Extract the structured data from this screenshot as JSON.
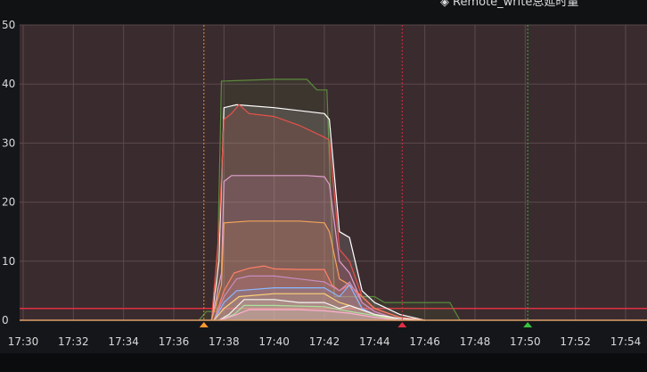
{
  "panel": {
    "legend_hint_text": "Remote_write总延时量",
    "legend_hint_icon": "diamond-icon"
  },
  "colors": {
    "background": "#3a2b2e",
    "grid": "#5a4a4d",
    "threshold": "#e02f44",
    "annotation_orange": "#ff9830",
    "annotation_red": "#e02f44",
    "annotation_green": "#37c23f"
  },
  "chart_data": {
    "type": "area",
    "title": "",
    "xlabel": "",
    "ylabel": "",
    "xlim": [
      "17:30",
      "17:54"
    ],
    "ylim": [
      0,
      50
    ],
    "x_ticks": [
      "17:30",
      "17:32",
      "17:34",
      "17:36",
      "17:38",
      "17:40",
      "17:42",
      "17:44",
      "17:46",
      "17:48",
      "17:50",
      "17:52",
      "17:54"
    ],
    "y_ticks": [
      0,
      10,
      20,
      30,
      40,
      50
    ],
    "grid": true,
    "stacked": false,
    "threshold": 2,
    "annotations": [
      {
        "time": "17:37.2",
        "color": "orange"
      },
      {
        "time": "17:45.1",
        "color": "red"
      },
      {
        "time": "17:50.1",
        "color": "green"
      }
    ],
    "series": [
      {
        "color": "#5a8a3c",
        "points": [
          [
            "17:37",
            0
          ],
          [
            "17:37.3",
            1.5
          ],
          [
            "17:37.7",
            1.5
          ],
          [
            "17:37.9",
            40.5
          ],
          [
            "17:40",
            40.8
          ],
          [
            "17:41.3",
            40.8
          ],
          [
            "17:41.7",
            39
          ],
          [
            "17:42.1",
            39
          ],
          [
            "17:42.4",
            4
          ],
          [
            "17:44",
            4
          ],
          [
            "17:44.4",
            3
          ],
          [
            "17:47",
            3
          ],
          [
            "17:47.4",
            0
          ]
        ]
      },
      {
        "color": "#ffffff",
        "points": [
          [
            "17:37.5",
            0
          ],
          [
            "17:37.8",
            10
          ],
          [
            "17:38",
            36
          ],
          [
            "17:38.5",
            36.5
          ],
          [
            "17:40",
            36
          ],
          [
            "17:42",
            35
          ],
          [
            "17:42.2",
            34
          ],
          [
            "17:42.6",
            15
          ],
          [
            "17:43",
            14
          ],
          [
            "17:43.5",
            5
          ],
          [
            "17:44",
            3
          ],
          [
            "17:45",
            1
          ],
          [
            "17:46",
            0
          ]
        ]
      },
      {
        "color": "#e8504a",
        "points": [
          [
            "17:37.5",
            0
          ],
          [
            "17:37.8",
            15
          ],
          [
            "17:38",
            34
          ],
          [
            "17:38.3",
            35
          ],
          [
            "17:38.6",
            36.5
          ],
          [
            "17:39",
            35
          ],
          [
            "17:40",
            34.5
          ],
          [
            "17:41",
            33
          ],
          [
            "17:42",
            31
          ],
          [
            "17:42.2",
            30.5
          ],
          [
            "17:42.6",
            12
          ],
          [
            "17:43",
            10
          ],
          [
            "17:43.5",
            4
          ],
          [
            "17:44",
            2
          ],
          [
            "17:45",
            0.5
          ],
          [
            "17:46",
            0
          ]
        ]
      },
      {
        "color": "#e0a0d0",
        "points": [
          [
            "17:37.5",
            0
          ],
          [
            "17:37.9",
            8
          ],
          [
            "17:38",
            23.5
          ],
          [
            "17:38.3",
            24.5
          ],
          [
            "17:40",
            24.5
          ],
          [
            "17:41.3",
            24.5
          ],
          [
            "17:42",
            24.3
          ],
          [
            "17:42.2",
            23
          ],
          [
            "17:42.6",
            10
          ],
          [
            "17:43",
            8
          ],
          [
            "17:43.5",
            3
          ],
          [
            "17:44",
            1.5
          ],
          [
            "17:45",
            0
          ]
        ]
      },
      {
        "color": "#f2a35a",
        "points": [
          [
            "17:37.5",
            0
          ],
          [
            "17:37.9",
            6
          ],
          [
            "17:38",
            16.5
          ],
          [
            "17:39",
            16.8
          ],
          [
            "17:41",
            16.8
          ],
          [
            "17:42",
            16.5
          ],
          [
            "17:42.2",
            15
          ],
          [
            "17:42.6",
            7
          ],
          [
            "17:43",
            6
          ],
          [
            "17:43.5",
            2
          ],
          [
            "17:44",
            1
          ],
          [
            "17:45",
            0
          ]
        ]
      },
      {
        "color": "#ff7f66",
        "points": [
          [
            "17:37.6",
            0
          ],
          [
            "17:38",
            5
          ],
          [
            "17:38.4",
            8
          ],
          [
            "17:39",
            8.8
          ],
          [
            "17:39.6",
            9.2
          ],
          [
            "17:40",
            8.7
          ],
          [
            "17:41",
            8.6
          ],
          [
            "17:42",
            8.6
          ],
          [
            "17:42.3",
            6
          ],
          [
            "17:42.6",
            5
          ],
          [
            "17:43",
            6
          ],
          [
            "17:43.5",
            4
          ],
          [
            "17:44",
            2
          ],
          [
            "17:45",
            0.5
          ],
          [
            "17:46",
            0
          ]
        ]
      },
      {
        "color": "#c88cc0",
        "points": [
          [
            "17:37.6",
            0
          ],
          [
            "17:38",
            4
          ],
          [
            "17:38.5",
            7
          ],
          [
            "17:39",
            7.5
          ],
          [
            "17:40",
            7.5
          ],
          [
            "17:41",
            7
          ],
          [
            "17:42",
            6.5
          ],
          [
            "17:42.6",
            5
          ],
          [
            "17:43",
            6.5
          ],
          [
            "17:43.5",
            3
          ],
          [
            "17:44",
            1.5
          ],
          [
            "17:45",
            0
          ]
        ]
      },
      {
        "color": "#8ab8ff",
        "points": [
          [
            "17:37.6",
            0
          ],
          [
            "17:38",
            3
          ],
          [
            "17:38.5",
            5
          ],
          [
            "17:40",
            5.5
          ],
          [
            "17:42",
            5.5
          ],
          [
            "17:42.6",
            4
          ],
          [
            "17:43",
            6
          ],
          [
            "17:43.5",
            2
          ],
          [
            "17:44",
            1
          ],
          [
            "17:45",
            0
          ]
        ]
      },
      {
        "color": "#ffd27a",
        "points": [
          [
            "17:37.6",
            0
          ],
          [
            "17:38",
            2
          ],
          [
            "17:38.6",
            4
          ],
          [
            "17:40",
            4.5
          ],
          [
            "17:42",
            4.5
          ],
          [
            "17:42.6",
            3
          ],
          [
            "17:43",
            2.5
          ],
          [
            "17:44",
            1
          ],
          [
            "17:45",
            0
          ]
        ]
      },
      {
        "color": "#f5f5f5",
        "points": [
          [
            "17:37.8",
            0
          ],
          [
            "17:38.2",
            1
          ],
          [
            "17:38.8",
            3.5
          ],
          [
            "17:40",
            3.5
          ],
          [
            "17:41",
            3
          ],
          [
            "17:42",
            3
          ],
          [
            "17:42.6",
            2
          ],
          [
            "17:43",
            2.5
          ],
          [
            "17:44",
            1
          ],
          [
            "17:45",
            0.3
          ],
          [
            "17:46",
            0
          ]
        ]
      },
      {
        "color": "#b0e0a0",
        "points": [
          [
            "17:37.8",
            0
          ],
          [
            "17:38.4",
            1
          ],
          [
            "17:38.8",
            2.5
          ],
          [
            "17:40",
            2.5
          ],
          [
            "17:42",
            2.3
          ],
          [
            "17:43",
            1.5
          ],
          [
            "17:44",
            0.8
          ],
          [
            "17:45",
            0
          ]
        ]
      },
      {
        "color": "#ffb0d0",
        "points": [
          [
            "17:37.8",
            0
          ],
          [
            "17:38.4",
            0.8
          ],
          [
            "17:39",
            1.8
          ],
          [
            "17:41",
            1.8
          ],
          [
            "17:42",
            1.6
          ],
          [
            "17:43",
            1.2
          ],
          [
            "17:44",
            0.5
          ],
          [
            "17:45",
            0
          ]
        ]
      }
    ]
  }
}
